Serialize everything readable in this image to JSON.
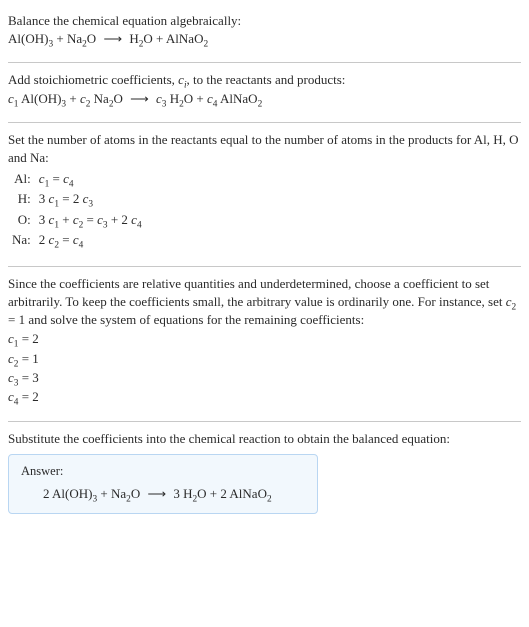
{
  "title": "Balance the chemical equation algebraically:",
  "main_eq": {
    "lhs1_sp": "Al(OH)",
    "lhs1_sub": "3",
    "plus1": " + ",
    "lhs2_sp": "Na",
    "lhs2_sub": "2",
    "lhs2_rest": "O",
    "arrow": "⟶",
    "rhs1_sp": "H",
    "rhs1_sub": "2",
    "rhs1_rest": "O",
    "plus2": " + ",
    "rhs2_sp": "AlNaO",
    "rhs2_sub": "2"
  },
  "step_coeffs_intro_a": "Add stoichiometric coefficients, ",
  "step_coeffs_intro_c": "c",
  "step_coeffs_intro_ci": "i",
  "step_coeffs_intro_b": ", to the reactants and products:",
  "coef_eq": {
    "c1": "c",
    "c1i": "1",
    "sp1a": " Al(OH)",
    "sp1b": "3",
    "plus1": " + ",
    "c2": "c",
    "c2i": "2",
    "sp2a": " Na",
    "sp2b": "2",
    "sp2c": "O",
    "arrow": "⟶",
    "c3": "c",
    "c3i": "3",
    "sp3a": " H",
    "sp3b": "2",
    "sp3c": "O",
    "plus2": " + ",
    "c4": "c",
    "c4i": "4",
    "sp4a": " AlNaO",
    "sp4b": "2"
  },
  "atoms_intro": "Set the number of atoms in the reactants equal to the number of atoms in the products for Al, H, O and Na:",
  "atoms": {
    "Al_lab": "Al:",
    "Al_expr": {
      "a": "c",
      "ai": "1",
      "eq": " = ",
      "b": "c",
      "bi": "4"
    },
    "H_lab": "H:",
    "H_expr": {
      "p": "3 ",
      "a": "c",
      "ai": "1",
      "eq": " = 2 ",
      "b": "c",
      "bi": "3"
    },
    "O_lab": "O:",
    "O_expr": {
      "p": "3 ",
      "a": "c",
      "ai": "1",
      "mid": " + ",
      "b": "c",
      "bi": "2",
      "eq": " = ",
      "c": "c",
      "ci": "3",
      "mid2": " + 2 ",
      "d": "c",
      "di": "4"
    },
    "Na_lab": "Na:",
    "Na_expr": {
      "p": "2 ",
      "a": "c",
      "ai": "2",
      "eq": " = ",
      "b": "c",
      "bi": "4"
    }
  },
  "arbitrary_intro_a": "Since the coefficients are relative quantities and underdetermined, choose a coefficient to set arbitrarily. To keep the coefficients small, the arbitrary value is ordinarily one. For instance, set ",
  "arbitrary_c": "c",
  "arbitrary_ci": "2",
  "arbitrary_intro_b": " = 1 and solve the system of equations for the remaining coefficients:",
  "solved": {
    "l1": {
      "c": "c",
      "ci": "1",
      "rest": " = 2"
    },
    "l2": {
      "c": "c",
      "ci": "2",
      "rest": " = 1"
    },
    "l3": {
      "c": "c",
      "ci": "3",
      "rest": " = 3"
    },
    "l4": {
      "c": "c",
      "ci": "4",
      "rest": " = 2"
    }
  },
  "subst_intro": "Substitute the coefficients into the chemical reaction to obtain the balanced equation:",
  "answer_label": "Answer:",
  "answer_eq": {
    "a": "2 Al(OH)",
    "as": "3",
    "plus1": " + Na",
    "b": "2",
    "brest": "O",
    "arrow": "⟶",
    "c": "3 H",
    "cs": "2",
    "crest": "O",
    "plus2": " + 2 AlNaO",
    "d": "2"
  },
  "chart_data": null
}
